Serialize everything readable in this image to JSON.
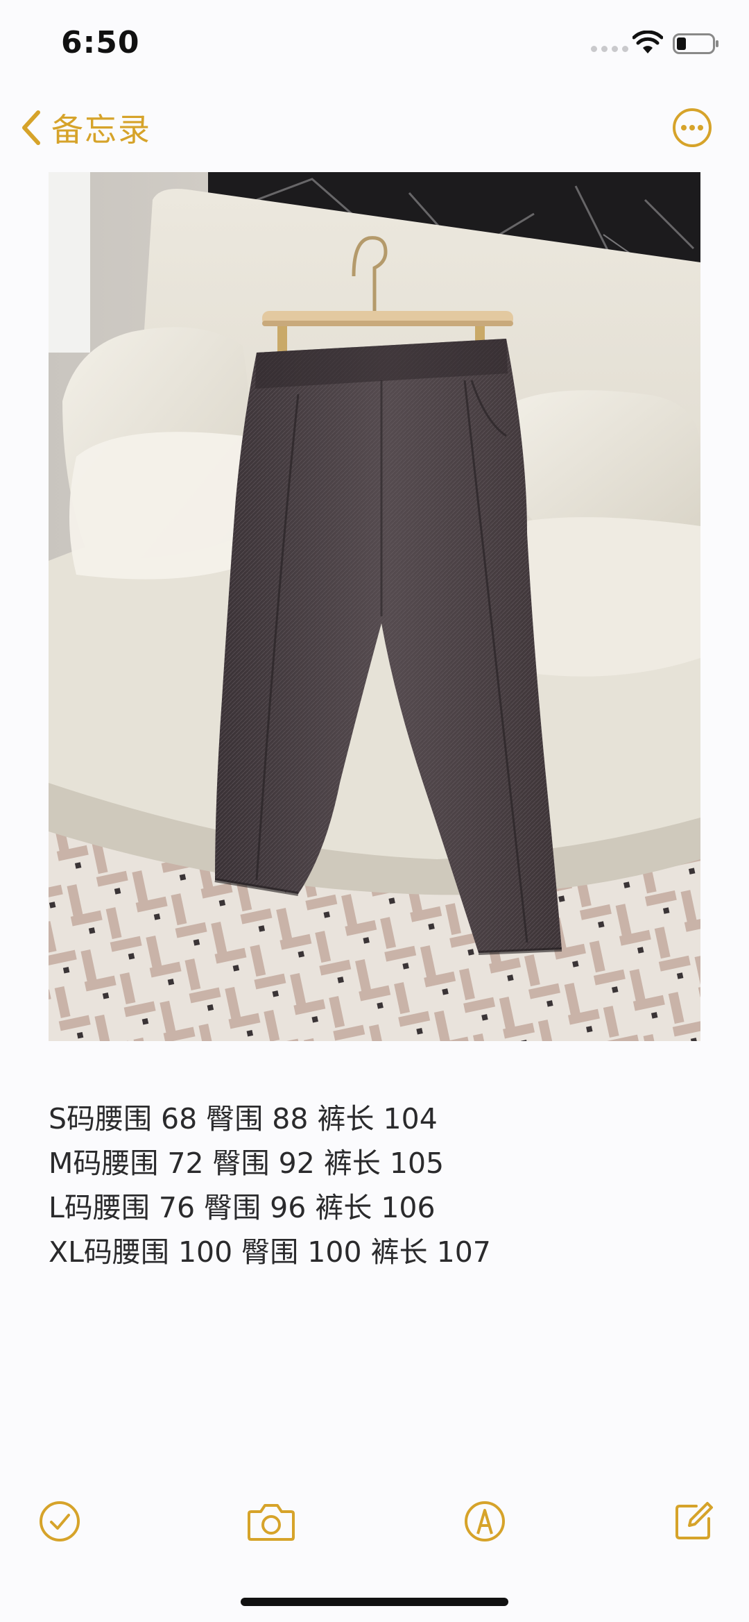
{
  "status_bar": {
    "time": "6:50"
  },
  "nav": {
    "back_label": "备忘录",
    "back_icon": "chevron-left-icon",
    "more_icon": "ellipsis-circle-icon"
  },
  "photo": {
    "icon": "photo-attachment"
  },
  "note": {
    "lines": [
      "S码腰围 68 臀围 88 裤长 104",
      "M码腰围 72 臀围 92 裤长 105",
      "L码腰围 76 臀围 96 裤长 106",
      "XL码腰围 100 臀围 100 裤长 107"
    ]
  },
  "toolbar": {
    "items": [
      {
        "icon": "checklist-icon"
      },
      {
        "icon": "camera-icon"
      },
      {
        "icon": "markup-pen-icon"
      },
      {
        "icon": "compose-icon"
      }
    ]
  },
  "colors": {
    "accent": "#d6a32a",
    "text": "#2a2a2c",
    "background": "#fbfbfd"
  }
}
